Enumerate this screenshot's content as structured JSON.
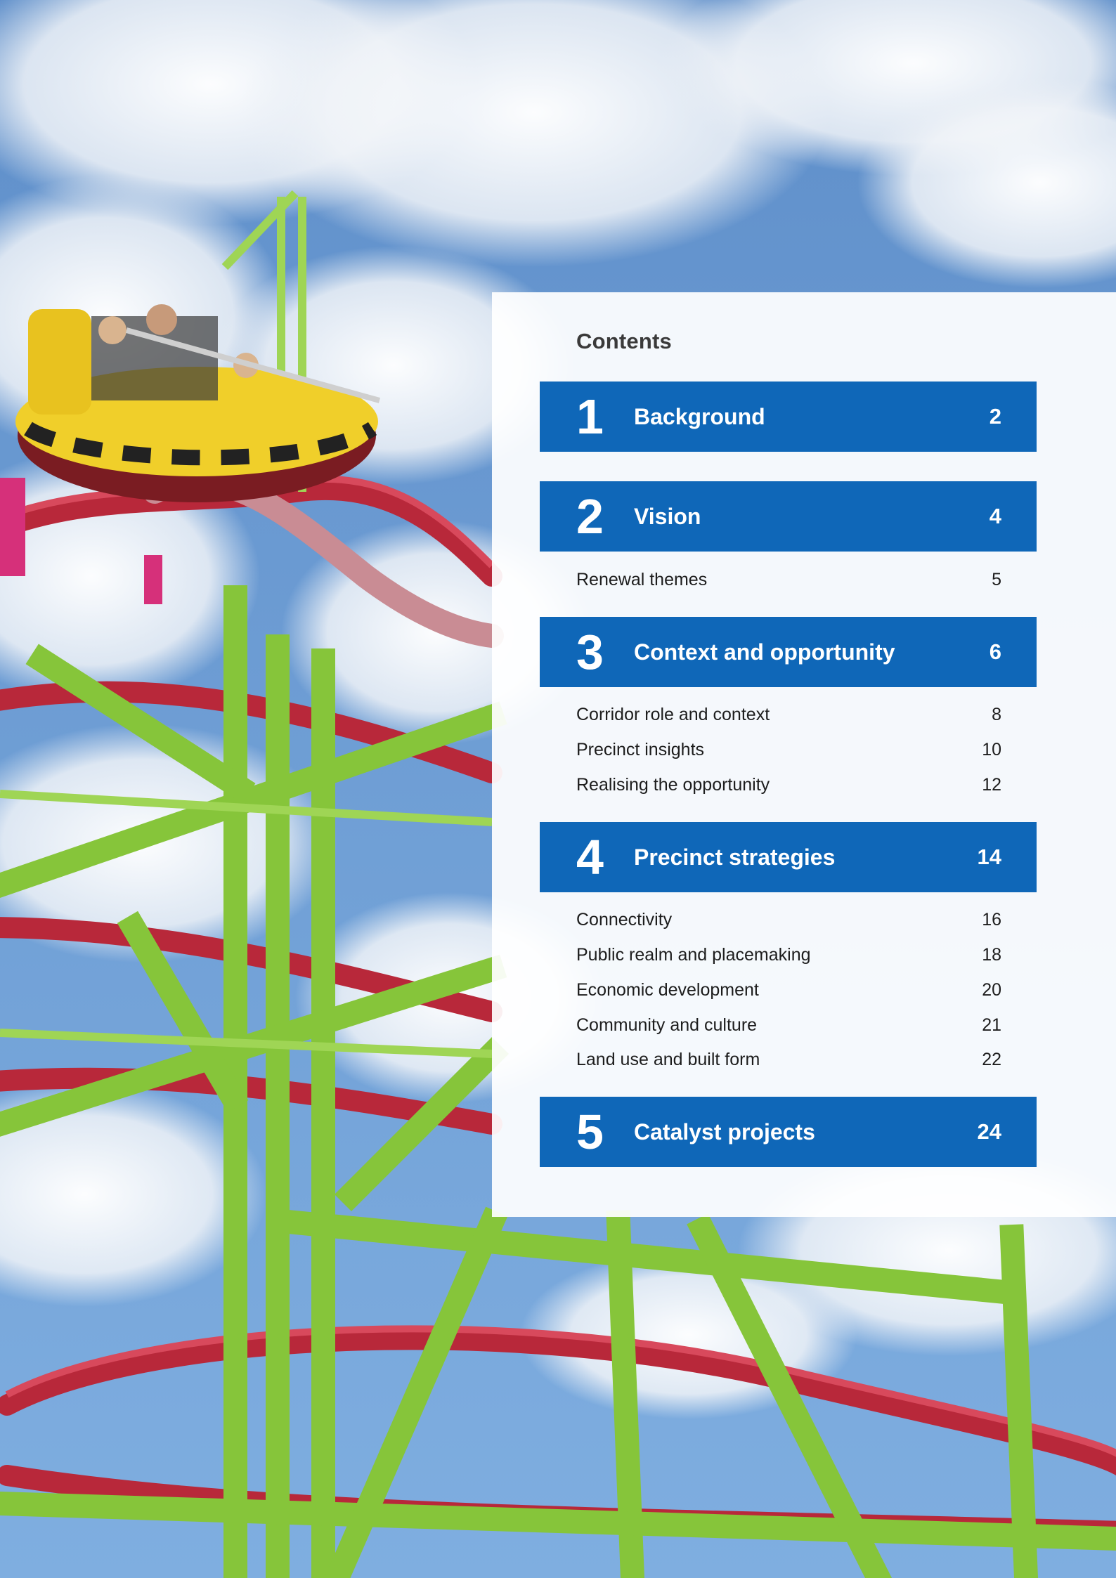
{
  "contents_title": "Contents",
  "colors": {
    "section_bg": "#0f67b8",
    "section_text": "#ffffff",
    "panel_bg": "#ffffff"
  },
  "sections": [
    {
      "number": "1",
      "title": "Background",
      "page": "2",
      "items": []
    },
    {
      "number": "2",
      "title": "Vision",
      "page": "4",
      "items": [
        {
          "title": "Renewal themes",
          "page": "5"
        }
      ]
    },
    {
      "number": "3",
      "title": "Context and opportunity",
      "page": "6",
      "items": [
        {
          "title": "Corridor role and context",
          "page": "8"
        },
        {
          "title": "Precinct insights",
          "page": "10"
        },
        {
          "title": "Realising the opportunity",
          "page": "12"
        }
      ]
    },
    {
      "number": "4",
      "title": "Precinct strategies",
      "page": "14",
      "items": [
        {
          "title": "Connectivity",
          "page": "16"
        },
        {
          "title": "Public realm and placemaking",
          "page": "18"
        },
        {
          "title": "Economic development",
          "page": "20"
        },
        {
          "title": "Community and culture",
          "page": "21"
        },
        {
          "title": "Land use and built form",
          "page": "22"
        }
      ]
    },
    {
      "number": "5",
      "title": "Catalyst projects",
      "page": "24",
      "items": []
    }
  ]
}
